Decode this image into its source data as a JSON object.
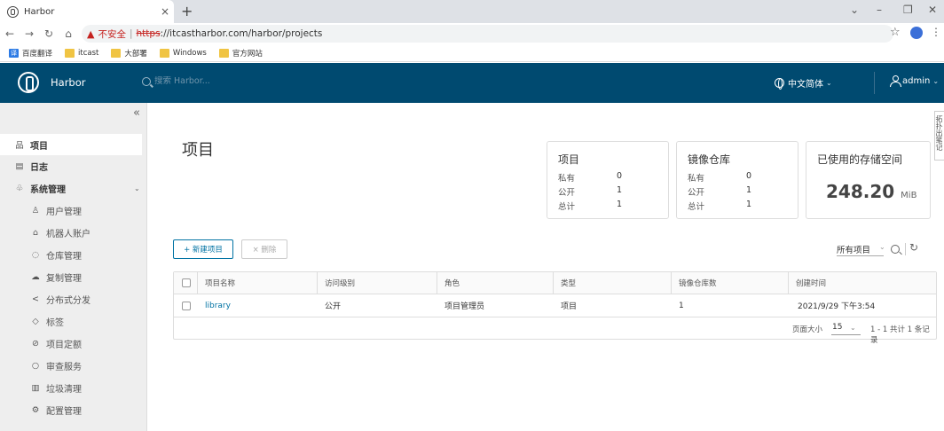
{
  "browser": {
    "tab_title": "Harbor",
    "tab_close": "×",
    "new_tab": "+",
    "address": {
      "insecure_label": "不安全",
      "scheme": "https",
      "url_rest": "://itcastharbor.com/harbor/projects"
    },
    "bookmarks": [
      {
        "label": "百度翻译",
        "icon": "translate-icon"
      },
      {
        "label": "itcast",
        "icon": "folder-icon"
      },
      {
        "label": "大部署",
        "icon": "folder-icon"
      },
      {
        "label": "Windows",
        "icon": "folder-icon"
      },
      {
        "label": "官方网站",
        "icon": "folder-icon"
      }
    ]
  },
  "header": {
    "brand": "Harbor",
    "search_placeholder": "搜索 Harbor...",
    "language": "中文简体",
    "user": "admin",
    "color": "#004a70"
  },
  "sidebar": {
    "collapse_glyph": "«",
    "items": [
      {
        "label": "项目",
        "icon": "projects-icon",
        "active": true
      },
      {
        "label": "日志",
        "icon": "logs-icon"
      },
      {
        "label": "系统管理",
        "icon": "admin-icon",
        "expanded": true
      },
      {
        "label": "用户管理",
        "icon": "users-icon"
      },
      {
        "label": "机器人账户",
        "icon": "robot-icon"
      },
      {
        "label": "仓库管理",
        "icon": "registry-icon"
      },
      {
        "label": "复制管理",
        "icon": "replication-icon"
      },
      {
        "label": "分布式分发",
        "icon": "distribution-icon"
      },
      {
        "label": "标签",
        "icon": "tag-icon"
      },
      {
        "label": "项目定额",
        "icon": "quota-icon"
      },
      {
        "label": "审查服务",
        "icon": "shield-icon"
      },
      {
        "label": "垃圾清理",
        "icon": "trash-icon"
      },
      {
        "label": "配置管理",
        "icon": "gear-icon"
      }
    ]
  },
  "main": {
    "title": "项目",
    "cards": {
      "projects": {
        "title": "项目",
        "rows": [
          {
            "label": "私有",
            "value": "0"
          },
          {
            "label": "公开",
            "value": "1"
          },
          {
            "label": "总计",
            "value": "1"
          }
        ]
      },
      "repos": {
        "title": "镜像仓库",
        "rows": [
          {
            "label": "私有",
            "value": "0"
          },
          {
            "label": "公开",
            "value": "1"
          },
          {
            "label": "总计",
            "value": "1"
          }
        ]
      },
      "storage": {
        "title": "已使用的存储空间",
        "value": "248.20",
        "unit": "MiB"
      }
    },
    "buttons": {
      "new_project": "+ 新建项目",
      "delete": "× 删除"
    },
    "filter": "所有项目",
    "table": {
      "columns": [
        "项目名称",
        "访问级别",
        "角色",
        "类型",
        "镜像仓库数",
        "创建时间"
      ],
      "rows": [
        {
          "name": "library",
          "access": "公开",
          "role": "项目管理员",
          "type": "项目",
          "repo_count": "1",
          "created": "2021/9/29 下午3:54"
        }
      ],
      "footer": {
        "page_size_label": "页面大小",
        "page_size": "15",
        "info": "1 - 1 共计 1 条记录"
      }
    }
  },
  "side_tab": "拓扑出笔记"
}
